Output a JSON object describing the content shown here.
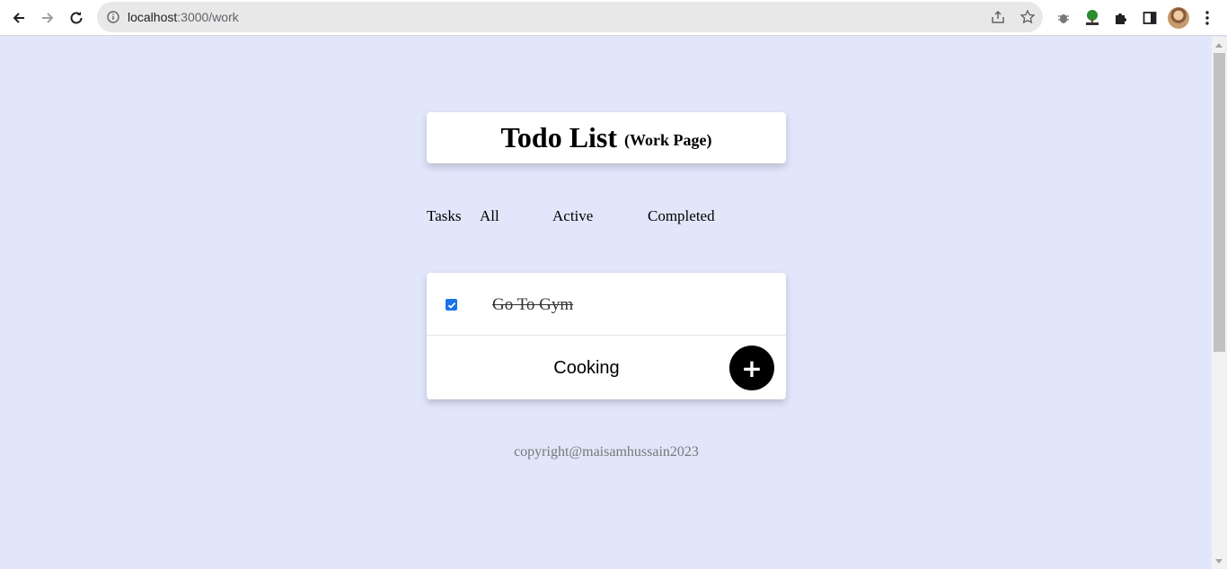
{
  "browser": {
    "url_host": "localhost",
    "url_path": ":3000/work"
  },
  "header": {
    "title": "Todo List",
    "subtitle": "(Work Page)"
  },
  "tabs": {
    "label": "Tasks",
    "items": [
      "All",
      "Active",
      "Completed"
    ]
  },
  "list": {
    "items": [
      {
        "text": "Go To Gym",
        "checked": true
      }
    ],
    "new_item_value": "Cooking",
    "add_label": "+"
  },
  "footer": {
    "text": "copyright@maisamhussain2023"
  },
  "colors": {
    "page_background": "#e1e6fb",
    "card_background": "#ffffff",
    "checkbox": "#1a73e8",
    "add_button": "#000000"
  }
}
